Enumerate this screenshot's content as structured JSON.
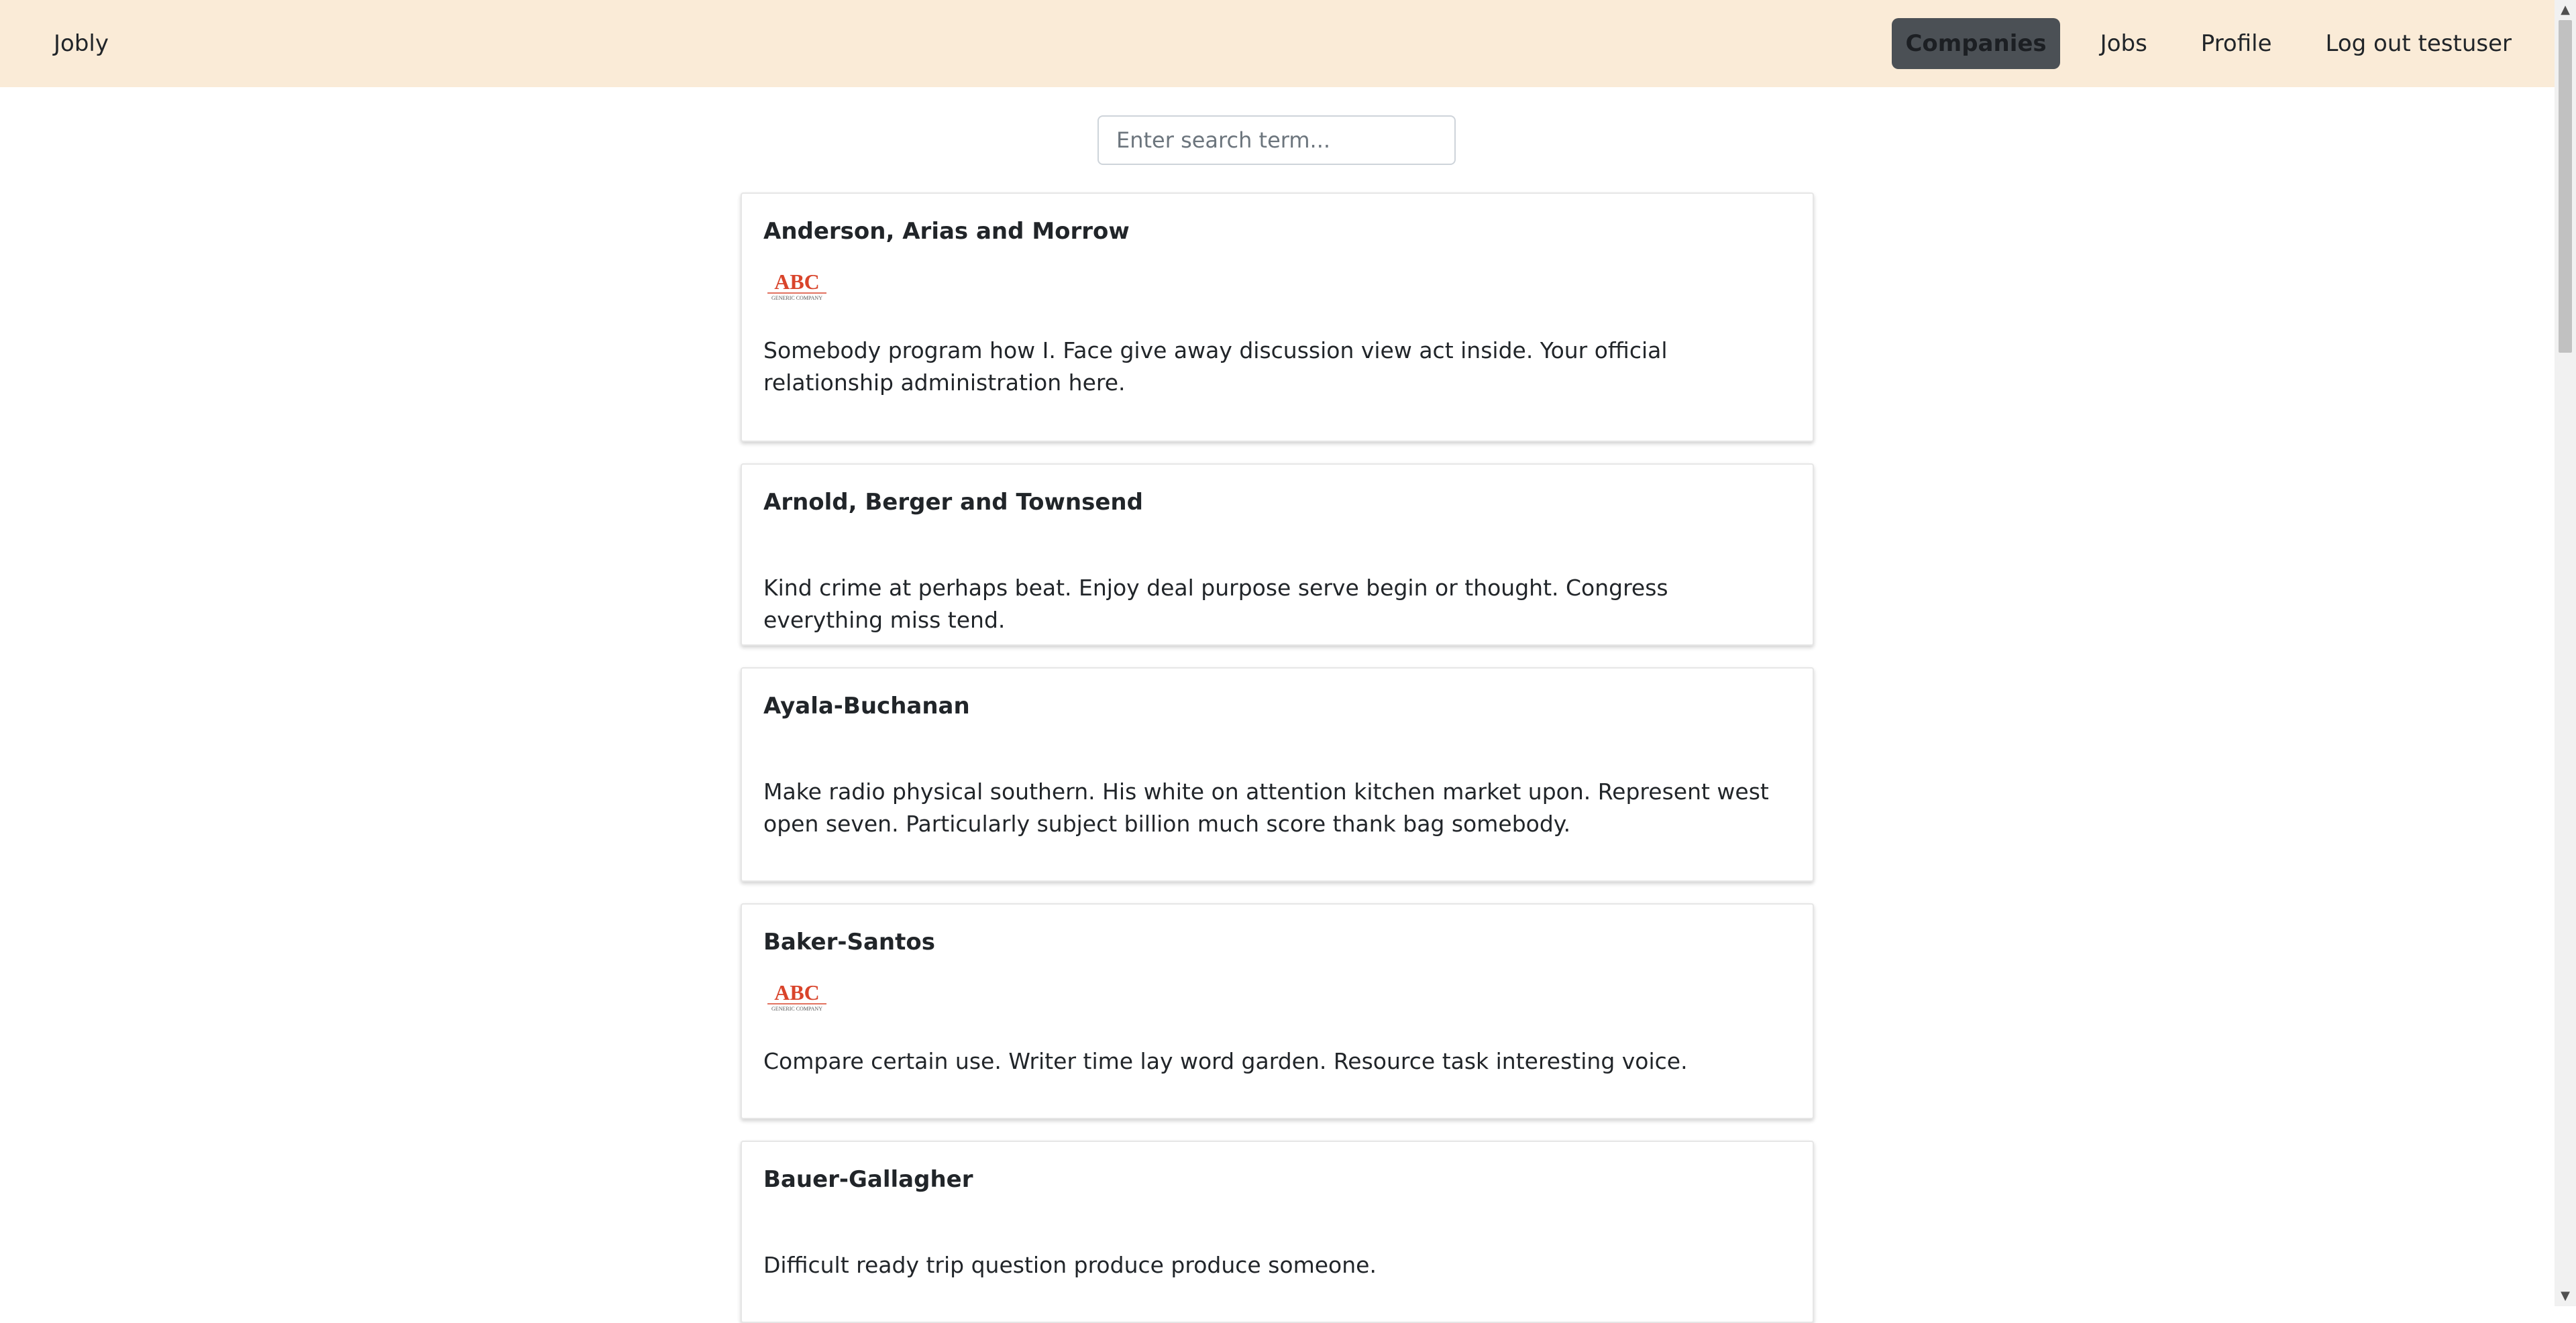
{
  "navbar": {
    "brand": "Jobly",
    "links": [
      {
        "label": "Companies",
        "active": true
      },
      {
        "label": "Jobs",
        "active": false
      },
      {
        "label": "Profile",
        "active": false
      },
      {
        "label": "Log out testuser",
        "active": false
      }
    ],
    "background_color": "#faebd7",
    "active_color": "#4b5055"
  },
  "search": {
    "placeholder": "Enter search term..."
  },
  "companies": [
    {
      "name": "Anderson, Arias and Morrow",
      "has_logo": true,
      "description": "Somebody program how I. Face give away discussion view act inside. Your official relationship administration here."
    },
    {
      "name": "Arnold, Berger and Townsend",
      "has_logo": false,
      "description": "Kind crime at perhaps beat. Enjoy deal purpose serve begin or thought. Congress everything miss tend."
    },
    {
      "name": "Ayala-Buchanan",
      "has_logo": false,
      "description": "Make radio physical southern. His white on attention kitchen market upon. Represent west open seven. Particularly subject billion much score thank bag somebody."
    },
    {
      "name": "Baker-Santos",
      "has_logo": true,
      "description": "Compare certain use. Writer time lay word garden. Resource task interesting voice."
    },
    {
      "name": "Bauer-Gallagher",
      "has_logo": false,
      "description": "Difficult ready trip question produce produce someone."
    }
  ],
  "logo": {
    "text": "ABC",
    "subtext": "GENERIC COMPANY"
  }
}
